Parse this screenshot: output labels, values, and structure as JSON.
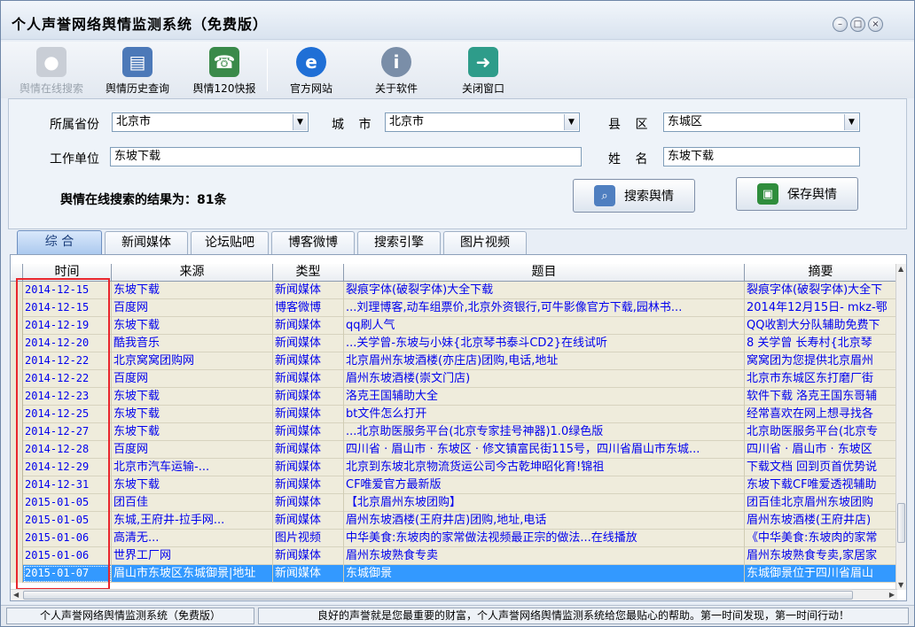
{
  "app": {
    "title": "个人声誉网络舆情监测系统（免费版）"
  },
  "window_controls": {
    "minimize": "–",
    "maximize": "□",
    "close": "×"
  },
  "toolbar": {
    "items": [
      {
        "label": "舆情在线搜索",
        "icon": "search-person-icon",
        "enabled": false
      },
      {
        "label": "舆情历史查询",
        "icon": "history-documents-icon",
        "enabled": true
      },
      {
        "label": "舆情120快报",
        "icon": "phone-report-icon",
        "enabled": true
      },
      {
        "label": "官方网站",
        "icon": "browser-e-icon",
        "enabled": true
      },
      {
        "label": "关于软件",
        "icon": "info-icon",
        "enabled": true
      },
      {
        "label": "关闭窗口",
        "icon": "exit-door-icon",
        "enabled": true
      }
    ]
  },
  "form": {
    "province_label": "所属省份",
    "province_value": "北京市",
    "city_label": "城 市",
    "city_value": "北京市",
    "district_label": "县 区",
    "district_value": "东城区",
    "work_label": "工作单位",
    "work_value": "东坡下载",
    "name_label": "姓 名",
    "name_value": "东坡下载",
    "result_text": "舆情在线搜索的结果为：81条",
    "search_button": "搜索舆情",
    "save_button": "保存舆情"
  },
  "tabs": [
    "综 合",
    "新闻媒体",
    "论坛贴吧",
    "博客微博",
    "搜索引擎",
    "图片视频"
  ],
  "active_tab": 0,
  "table": {
    "headers": [
      "时间",
      "来源",
      "类型",
      "题目",
      "摘要"
    ],
    "rows": [
      [
        "2014-12-15",
        "东坡下载",
        "新闻媒体",
        "裂痕字体(破裂字体)大全下载",
        "裂痕字体(破裂字体)大全下"
      ],
      [
        "2014-12-15",
        "百度网",
        "博客微博",
        "...刘理博客,动车组票价,北京外资银行,可牛影像官方下载,园林书...",
        "2014年12月15日- mkz-鄂"
      ],
      [
        "2014-12-19",
        "东坡下载",
        "新闻媒体",
        "qq刷人气",
        "QQ收割大分队辅助免费下"
      ],
      [
        "2014-12-20",
        "酷我音乐",
        "新闻媒体",
        "...关学曾-东坡与小妹{北京琴书泰斗CD2}在线试听",
        "8 关学曾 长寿村{北京琴"
      ],
      [
        "2014-12-22",
        "北京窝窝团购网",
        "新闻媒体",
        "北京眉州东坡酒楼(亦庄店)团购,电话,地址",
        "窝窝团为您提供北京眉州"
      ],
      [
        "2014-12-22",
        "百度网",
        "新闻媒体",
        "眉州东坡酒楼(崇文门店)",
        "北京市东城区东打磨厂街"
      ],
      [
        "2014-12-23",
        "东坡下载",
        "新闻媒体",
        "洛克王国辅助大全",
        "软件下载 洛克王国东哥辅"
      ],
      [
        "2014-12-25",
        "东坡下载",
        "新闻媒体",
        "bt文件怎么打开",
        "经常喜欢在网上想寻找各"
      ],
      [
        "2014-12-27",
        "东坡下载",
        "新闻媒体",
        "...北京助医服务平台(北京专家挂号神器)1.0绿色版",
        "北京助医服务平台(北京专"
      ],
      [
        "2014-12-28",
        "百度网",
        "新闻媒体",
        "四川省 · 眉山市 · 东坡区 · 修文镇富民街115号，四川省眉山市东城...",
        "四川省 · 眉山市 · 东坡区"
      ],
      [
        "2014-12-29",
        "北京市汽车运输-...",
        "新闻媒体",
        "北京到东坡北京物流货运公司今古乾坤昭化育!锦祖",
        "下载文档 回到页首优势说"
      ],
      [
        "2014-12-31",
        "东坡下载",
        "新闻媒体",
        "CF唯爱官方最新版",
        "东坡下载CF唯爱透视辅助"
      ],
      [
        "2015-01-05",
        "团百佳",
        "新闻媒体",
        "【北京眉州东坡团购】",
        "团百佳北京眉州东坡团购"
      ],
      [
        "2015-01-05",
        "东城,王府井-拉手网...",
        "新闻媒体",
        "眉州东坡酒楼(王府井店)团购,地址,电话",
        "眉州东坡酒楼(王府井店)"
      ],
      [
        "2015-01-06",
        "高清无...",
        "图片视频",
        "中华美食:东坡肉的家常做法视频最正宗的做法...在线播放",
        "《中华美食:东坡肉的家常"
      ],
      [
        "2015-01-06",
        "世界工厂网",
        "新闻媒体",
        "眉州东坡熟食专卖",
        "眉州东坡熟食专卖,家居家"
      ],
      [
        "2015-01-07",
        "眉山市东坡区东城御景|地址",
        "新闻媒体",
        "东城御景",
        "东城御景位于四川省眉山"
      ]
    ],
    "selected_row": 16
  },
  "status": {
    "left": "个人声誉网络舆情监测系统（免费版）",
    "right": "良好的声誉就是您最重要的财富，个人声誉网络舆情监测系统给您最贴心的帮助。第一时间发现，第一时间行动！"
  },
  "colors": {
    "highlight_box": "#e8262d",
    "selected_row": "#3399ff",
    "link_text": "#0000ee",
    "row_bg": "#efecdc"
  }
}
